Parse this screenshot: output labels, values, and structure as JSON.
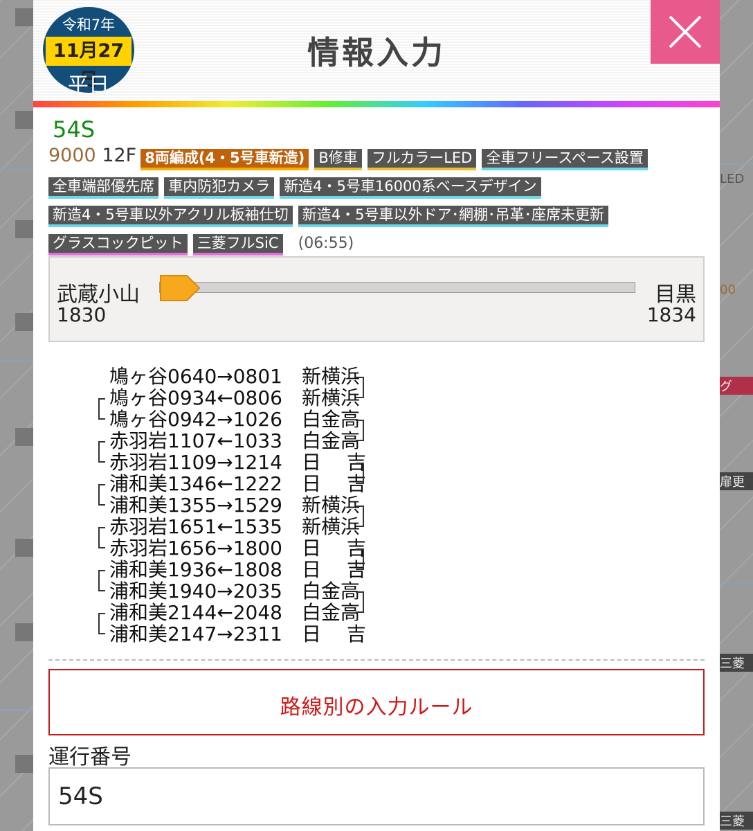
{
  "background": {
    "right_fragments": [
      "LED",
      "00",
      "グ",
      "扉更",
      "三菱",
      "三菱"
    ]
  },
  "date_badge": {
    "era": "令和7年",
    "date": "11月27日",
    "day_type": "平日"
  },
  "header": {
    "title": "情報入力",
    "close_icon": "close-x-icon"
  },
  "train": {
    "run_number": "54S",
    "series": "9000",
    "formation": "12F",
    "tags": [
      {
        "label": "8両編成(4・5号車新造)",
        "style": "orange"
      },
      {
        "label": "B修車",
        "style": "u-yellow"
      },
      {
        "label": "フルカラーLED",
        "style": "u-yellow"
      },
      {
        "label": "全車フリースペース設置",
        "style": "u-cyan"
      },
      {
        "label": "全車端部優先席",
        "style": "u-cyan"
      },
      {
        "label": "車内防犯カメラ",
        "style": "u-cyan"
      },
      {
        "label": "新造4・5号車16000系ベースデザイン",
        "style": "u-cyan"
      },
      {
        "label": "新造4・5号車以外アクリル板袖仕切",
        "style": "u-cyan"
      },
      {
        "label": "新造4・5号車以外ドア･網棚･吊革･座席未更新",
        "style": "u-cyan"
      },
      {
        "label": "グラスコックピット",
        "style": "u-pink"
      },
      {
        "label": "三菱フルSiC",
        "style": "u-pink"
      }
    ],
    "time_note": "(06:55)"
  },
  "segment_slider": {
    "from_station": "武蔵小山",
    "from_train": "1830",
    "to_station": "目黒",
    "to_train": "1834",
    "position": 0
  },
  "schedule": [
    {
      "text": "鳩ヶ谷0640→0801",
      "dest": "新横浜"
    },
    {
      "text": "鳩ヶ谷0934←0806",
      "dest": "新横浜"
    },
    {
      "text": "鳩ヶ谷0942→1026",
      "dest": "白金高"
    },
    {
      "text": "赤羽岩1107←1033",
      "dest": "白金高"
    },
    {
      "text": "赤羽岩1109→1214",
      "dest": "日　 吉"
    },
    {
      "text": "浦和美1346←1222",
      "dest": "日　 吉"
    },
    {
      "text": "浦和美1355→1529",
      "dest": "新横浜"
    },
    {
      "text": "赤羽岩1651←1535",
      "dest": "新横浜"
    },
    {
      "text": "赤羽岩1656→1800",
      "dest": "日　 吉"
    },
    {
      "text": "浦和美1936←1808",
      "dest": "日　 吉"
    },
    {
      "text": "浦和美1940→2035",
      "dest": "白金高"
    },
    {
      "text": "浦和美2144←2048",
      "dest": "白金高"
    },
    {
      "text": "浦和美2147→2311",
      "dest": "日　 吉"
    }
  ],
  "rule_button": {
    "label": "路線別の入力ルール"
  },
  "run_number_field": {
    "label": "運行番号",
    "value": "54S"
  }
}
